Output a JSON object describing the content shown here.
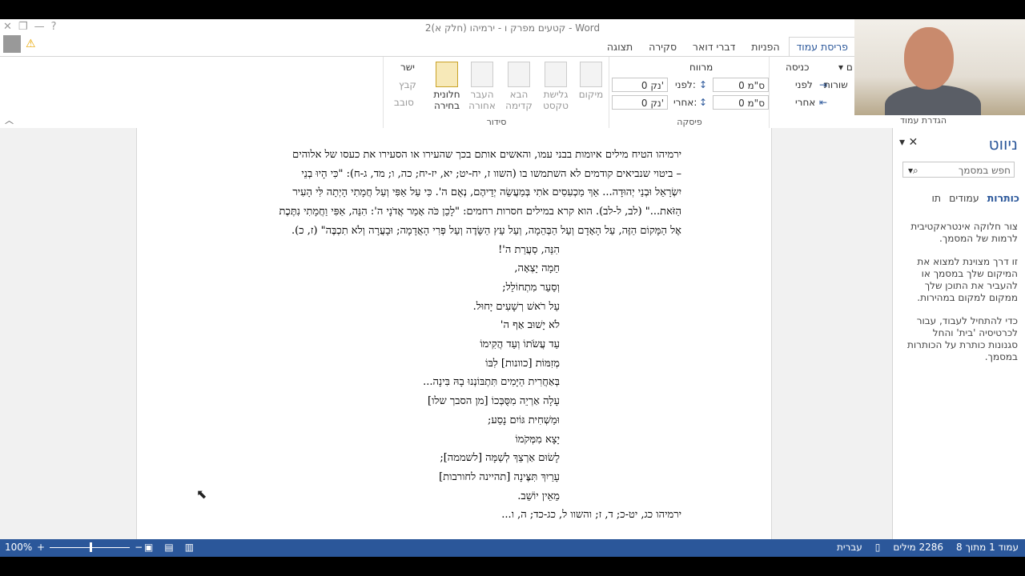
{
  "window": {
    "title": "קטעים מפרק ו - ירמיהו (חלק א)2 - Word"
  },
  "qat": {
    "close": "✕",
    "restore": "❐",
    "minimize": "—",
    "help": "?"
  },
  "tabs": [
    "פריסת עמוד",
    "הפניות",
    "דברי דואר",
    "סקירה",
    "תצוגה"
  ],
  "ribbon": {
    "indent_group": {
      "label": "הגדרת עמוד",
      "indent_before_label": "לפני",
      "indent_before_value": "0 ס\"מ",
      "indent_after_label": "אחרי",
      "indent_after_value": "0 ס\"מ",
      "header": "כניסה",
      "lines_label": "שורות"
    },
    "spacing_group": {
      "header": "מרווח",
      "before_label": "לפני:",
      "before_value": "0 נק'",
      "after_label": "אחרי:",
      "after_value": "0 נק'",
      "group_label": "פיסקה"
    },
    "arrange_group": {
      "label": "סידור",
      "position": "מיקום",
      "wrap": "גלישת טקסט",
      "forward": "הבא קדימה",
      "backward": "העבר אחורה",
      "selection_pane": "חלונית בחירה",
      "align": "ישר",
      "group": "קבץ",
      "rotate": "סובב"
    }
  },
  "document": {
    "paragraph_lines": [
      "ירמיהו הטיח מילים איומות בבני עמו, והאשים אותם בכך שהעירו או הסעירו את כעסו של אלוהים",
      "– ביטוי שנביאים קודמים לא השתמשו בו (השוו ז, יח-יט; יא, יז-יח; כה, ו; מד, ג-ח): \"כִּי הָיוּ בְנֵי",
      "יִשְׂרָאֵל וּבְנֵי יְהוּדָה... אַךְ מַכְעִסִים אֹתִי בְּמַעֲשֵׂה יְדֵיהֶם, נְאֻם ה'. כִּי עַל אַפִּי וְעַל חֲמָתִי הָיְתָה לִּי הָעִיר",
      "הַזֹּאת...\" (לב, ל-לב). הוא קרא במילים חסרות רחמים: \"לָכֵן כֹּה אָמַר אֲדֹנָי ה': הִנֵּה, אַפִּי וַחֲמָתִי נִתֶּכֶת",
      "אֶל הַמָּקוֹם הַזֶּה, עַל הָאָדָם וְעַל הַבְּהֵמָה, וְעַל עֵץ הַשָּׂדֶה וְעַל פְּרִי הָאֲדָמָה; וּבָעֲרָה וְלֹא תִכְבֶּה\" (ז, כ)."
    ],
    "poem_lines": [
      "הִנֵּה, סַעֲרַת ה'!",
      "חֵמָה יָצְאָה,",
      "וְסַעַר מִתְחוֹלֵל;",
      "עַל רֹאשׁ רְשָׁעִים יָחוּל.",
      "לֹא יָשׁוּב אַף ה'",
      "עַד עֲשֹׂתוֹ וְעַד הֲקִימוֹ",
      "מְזִמּוֹת [כוונות] לִבּוֹ",
      "בְּאַחֲרִית הַיָּמִים תִּתְבּוֹנְנוּ בָהּ בִּינָה...",
      "עָלָה אַרְיֵה מִסֻּבְּכוֹ [מן הסבך שלו]",
      "וּמַשְׁחִית גּוֹיִם נָסַע;",
      "יָצָא מִמְּקֹמוֹ",
      "לָשׂוּם אַרְצֵךְ לְשַׁמָּה [לשממה];",
      "עָרַיִךְ תִּצֶּינָה [תהיינה לחורבות]",
      "מֵאֵין יוֹשֵׁב."
    ],
    "reference_line": "ירמיהו כג, יט-כ; ד, ז; והשוו ל, כג-כד; ה, ו..."
  },
  "nav_pane": {
    "title": "ניווט",
    "search_placeholder": "חפש במסמך",
    "tabs": [
      "כותרות",
      "עמודים",
      "תו"
    ],
    "paragraphs": [
      "צור חלוקה אינטראקטיבית לרמות של המסמך.",
      "זו דרך מצוינת למצוא את המיקום שלך במסמך או להעביר את התוכן שלך ממקום למקום במהירות.",
      "כדי להתחיל לעבוד, עבור לכרטיסיה 'בית' והחל סגנונות כותרת על הכותרות במסמך."
    ]
  },
  "status": {
    "zoom": "100%",
    "page": "עמוד 1 מתוך 8",
    "words": "2286 מילים",
    "language": "עברית"
  },
  "colors": {
    "accent": "#2b579a",
    "status_bar": "#2b579a"
  }
}
